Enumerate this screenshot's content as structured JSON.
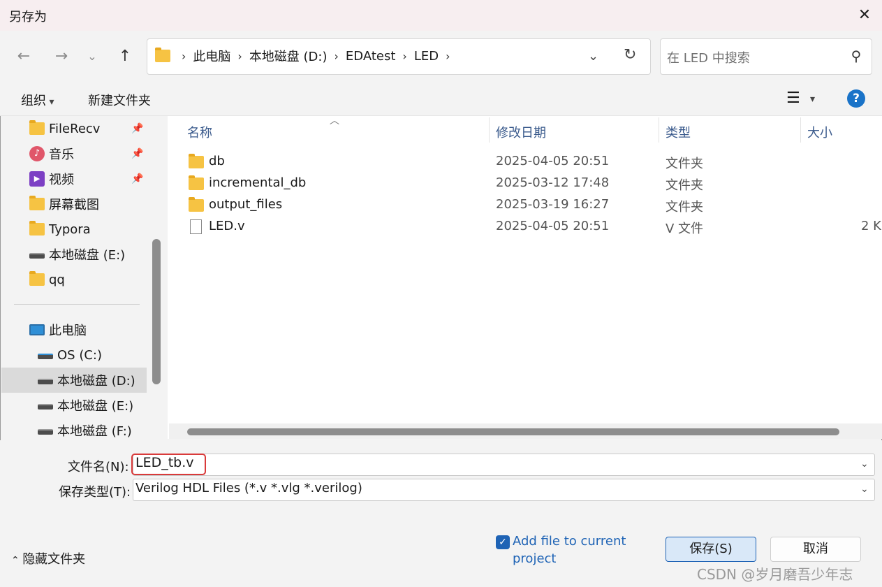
{
  "title": "另存为",
  "breadcrumb": [
    "此电脑",
    "本地磁盘 (D:)",
    "EDAtest",
    "LED"
  ],
  "search_placeholder": "在 LED 中搜索",
  "toolbar": {
    "organize": "组织",
    "new_folder": "新建文件夹"
  },
  "sidebar": {
    "quick": [
      {
        "label": "FileRecv",
        "icon": "folder-icon",
        "pinned": true
      },
      {
        "label": "音乐",
        "icon": "music-icon",
        "pinned": true
      },
      {
        "label": "视频",
        "icon": "video-icon",
        "pinned": true
      },
      {
        "label": "屏幕截图",
        "icon": "folder-icon",
        "pinned": false
      },
      {
        "label": "Typora",
        "icon": "folder-icon",
        "pinned": false
      },
      {
        "label": "本地磁盘 (E:)",
        "icon": "drive-icon",
        "pinned": false
      },
      {
        "label": "qq",
        "icon": "folder-icon",
        "pinned": false
      }
    ],
    "this_pc": "此电脑",
    "drives": [
      "OS (C:)",
      "本地磁盘 (D:)",
      "本地磁盘 (E:)",
      "本地磁盘 (F:)"
    ]
  },
  "columns": {
    "name": "名称",
    "modified": "修改日期",
    "type": "类型",
    "size": "大小"
  },
  "files": [
    {
      "name": "db",
      "modified": "2025-04-05 20:51",
      "type": "文件夹",
      "size": ""
    },
    {
      "name": "incremental_db",
      "modified": "2025-03-12 17:48",
      "type": "文件夹",
      "size": ""
    },
    {
      "name": "output_files",
      "modified": "2025-03-19 16:27",
      "type": "文件夹",
      "size": ""
    },
    {
      "name": "LED.v",
      "modified": "2025-04-05 20:51",
      "type": "V 文件",
      "size": "2 K"
    }
  ],
  "filename_label": "文件名(N):",
  "filename_value": "LED_tb.v",
  "filetype_label": "保存类型(T):",
  "filetype_value": "Verilog HDL Files (*.v *.vlg *.verilog)",
  "add_to_project_line1": "Add file to current",
  "add_to_project_line2": "project",
  "save_label": "保存(S)",
  "cancel_label": "取消",
  "hide_folders_label": "隐藏文件夹",
  "watermark": "CSDN @岁月磨吾少年志",
  "colors": {
    "accent": "#1e63b5",
    "highlight_box": "#d93a3a",
    "folder": "#f6c343"
  }
}
